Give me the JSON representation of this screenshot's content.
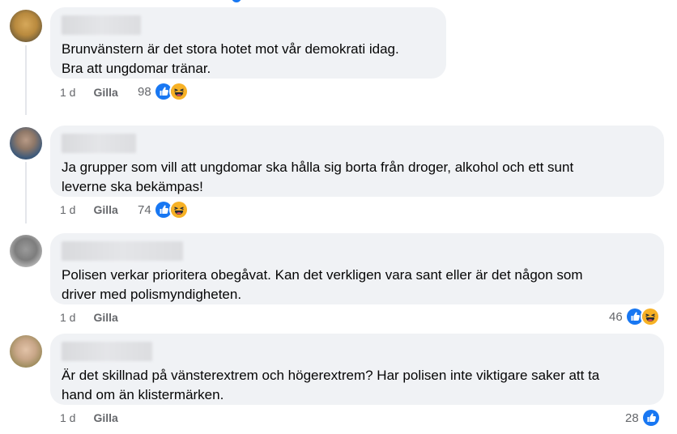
{
  "colors": {
    "bubble": "#f0f2f5",
    "meta": "#65676b",
    "like_blue": "#1877f2",
    "haha_yellow": "#f7b125"
  },
  "comments": [
    {
      "text_lines": [
        "Brunvänstern är det stora hotet mot vår demokrati idag.",
        "Bra att ungdomar tränar."
      ],
      "time": "1 d",
      "like_label": "Gilla",
      "reaction_count": "98",
      "reactions": [
        "like-icon",
        "haha-icon"
      ]
    },
    {
      "text_lines": [
        "Ja grupper som vill att ungdomar ska hålla sig borta från droger, alkohol och ett sunt",
        "leverne ska bekämpas!"
      ],
      "time": "1 d",
      "like_label": "Gilla",
      "reaction_count": "74",
      "reactions": [
        "like-icon",
        "haha-icon"
      ]
    },
    {
      "text_lines": [
        "Polisen verkar prioritera obegåvat. Kan det verkligen vara sant eller är det någon som",
        "driver med polismyndigheten."
      ],
      "time": "1 d",
      "like_label": "Gilla",
      "reaction_count": "46",
      "reactions": [
        "like-icon",
        "haha-icon"
      ]
    },
    {
      "text_lines": [
        "Är det skillnad på vänsterextrem och högerextrem? Har polisen inte viktigare saker att ta",
        "hand om än klistermärken."
      ],
      "time": "1 d",
      "like_label": "Gilla",
      "reaction_count": "28",
      "reactions": [
        "like-icon"
      ]
    }
  ]
}
